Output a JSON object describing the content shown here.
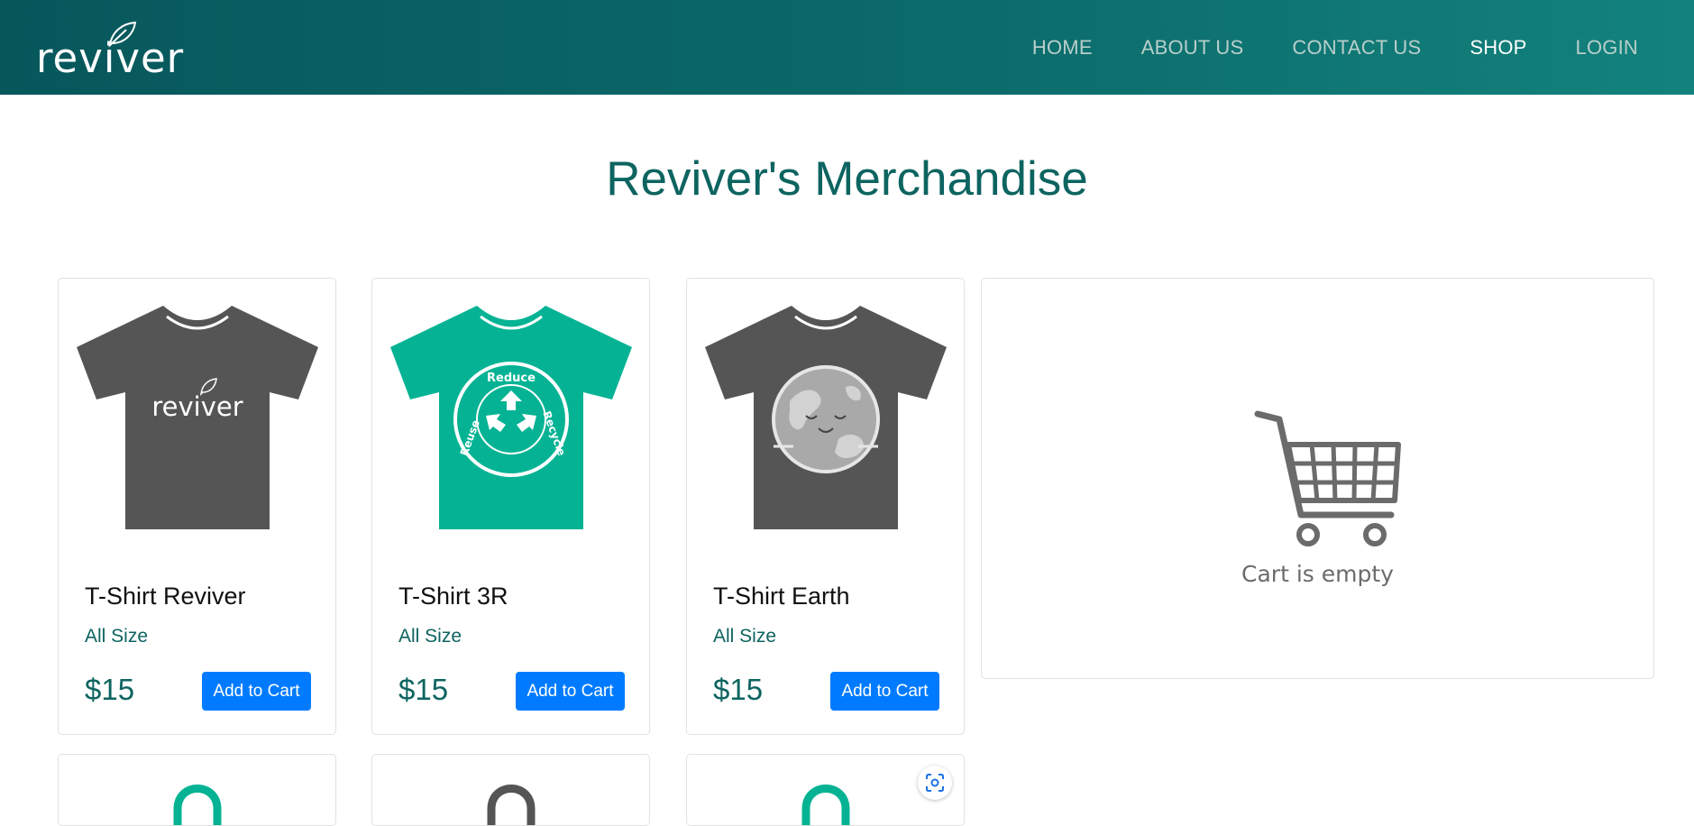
{
  "brand": {
    "name": "reviver"
  },
  "nav": {
    "items": [
      {
        "label": "HOME",
        "active": false
      },
      {
        "label": "ABOUT US",
        "active": false
      },
      {
        "label": "CONTACT US",
        "active": false
      },
      {
        "label": "SHOP",
        "active": true
      },
      {
        "label": "LOGIN",
        "active": false
      }
    ]
  },
  "page": {
    "title": "Reviver's Merchandise"
  },
  "products": [
    {
      "name": "T-Shirt Reviver",
      "size": "All Size",
      "price": "$15",
      "button": "Add to Cart",
      "shirt_color": "#555555",
      "print": "reviver",
      "icon": "tshirt-reviver-icon"
    },
    {
      "name": "T-Shirt 3R",
      "size": "All Size",
      "price": "$15",
      "button": "Add to Cart",
      "shirt_color": "#05b394",
      "print_words": [
        "Reduce",
        "Reuse",
        "Recycle"
      ],
      "icon": "tshirt-3r-icon"
    },
    {
      "name": "T-Shirt Earth",
      "size": "All Size",
      "price": "$15",
      "button": "Add to Cart",
      "shirt_color": "#555555",
      "icon": "tshirt-earth-icon"
    }
  ],
  "bags": [
    {
      "color": "#05b394",
      "icon": "tote-bag-icon"
    },
    {
      "color": "#555555",
      "icon": "tote-bag-icon"
    },
    {
      "color": "#05b394",
      "icon": "tote-bag-icon"
    }
  ],
  "cart": {
    "empty_text": "Cart is empty",
    "icon": "shopping-cart-icon"
  },
  "colors": {
    "brand": "#0d6460",
    "nav_bg_start": "#07575b",
    "nav_bg_end": "#13827d",
    "button": "#007bff"
  },
  "overlay": {
    "icon": "google-lens-icon"
  }
}
